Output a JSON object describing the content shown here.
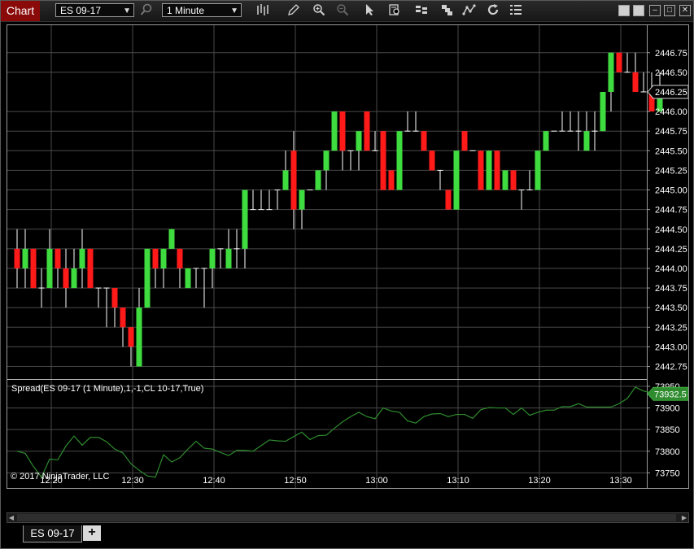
{
  "toolbar": {
    "chart_tab": "Chart",
    "instrument": "ES 09-17",
    "interval": "1 Minute"
  },
  "indicator_label": "Spread(ES 09-17 (1 Minute),1,-1,CL 10-17,True)",
  "copyright": "© 2017 NinjaTrader, LLC",
  "bottom_tab": "ES 09-17",
  "add_tab_label": "+",
  "colors": {
    "up": "#3fdc3f",
    "down": "#ff1a1a",
    "grid": "#4a4a4a",
    "spread": "#2e8b2e",
    "marker_fill": "#000000"
  },
  "chart_data": [
    {
      "type": "candlestick",
      "instrument": "ES 09-17",
      "interval": "1 Minute",
      "x_tick_labels": [
        "12:20",
        "12:30",
        "12:40",
        "12:50",
        "13:00",
        "13:10",
        "13:20",
        "13:30"
      ],
      "y_tick_labels": [
        "2446.75",
        "2446.50",
        "2446.00",
        "2445.75",
        "2445.50",
        "2445.25",
        "2445.00",
        "2444.75",
        "2444.50",
        "2444.25",
        "2444.00",
        "2443.75",
        "2443.50",
        "2443.25",
        "2443.00",
        "2442.75"
      ],
      "ylim": [
        2442.6,
        2447.1
      ],
      "last_price_label": "2446.25",
      "last_price": 2446.25,
      "bars": [
        [
          2444.25,
          2444.5,
          2443.75,
          2444.0
        ],
        [
          2444.0,
          2444.5,
          2443.75,
          2444.25
        ],
        [
          2444.25,
          2444.25,
          2443.75,
          2443.75
        ],
        [
          2443.75,
          2444.0,
          2443.5,
          2443.75
        ],
        [
          2443.75,
          2444.5,
          2443.75,
          2444.25
        ],
        [
          2444.25,
          2444.25,
          2443.75,
          2444.0
        ],
        [
          2444.0,
          2444.25,
          2443.5,
          2443.75
        ],
        [
          2443.75,
          2444.25,
          2443.75,
          2444.0
        ],
        [
          2444.0,
          2444.5,
          2443.75,
          2444.25
        ],
        [
          2444.25,
          2444.25,
          2443.75,
          2443.75
        ],
        [
          2443.75,
          2443.75,
          2443.5,
          2443.75
        ],
        [
          2443.75,
          2443.75,
          2443.25,
          2443.75
        ],
        [
          2443.75,
          2443.75,
          2443.25,
          2443.5
        ],
        [
          2443.5,
          2443.5,
          2443.0,
          2443.25
        ],
        [
          2443.25,
          2443.25,
          2442.75,
          2443.0
        ],
        [
          2442.75,
          2443.75,
          2442.75,
          2443.5
        ],
        [
          2443.5,
          2444.25,
          2443.5,
          2444.25
        ],
        [
          2444.25,
          2444.25,
          2443.75,
          2444.0
        ],
        [
          2444.0,
          2444.25,
          2443.75,
          2444.25
        ],
        [
          2444.25,
          2444.5,
          2444.25,
          2444.5
        ],
        [
          2444.25,
          2444.25,
          2443.75,
          2444.0
        ],
        [
          2443.75,
          2444.0,
          2443.75,
          2444.0
        ],
        [
          2444.0,
          2444.0,
          2443.75,
          2444.0
        ],
        [
          2444.0,
          2444.0,
          2443.5,
          2444.0
        ],
        [
          2444.0,
          2444.25,
          2443.75,
          2444.25
        ],
        [
          2444.25,
          2444.25,
          2444.0,
          2444.25
        ],
        [
          2444.0,
          2444.5,
          2444.0,
          2444.25
        ],
        [
          2444.25,
          2444.5,
          2444.0,
          2444.25
        ],
        [
          2444.25,
          2445.0,
          2444.0,
          2445.0
        ],
        [
          2444.75,
          2445.0,
          2444.75,
          2444.75
        ],
        [
          2444.75,
          2445.0,
          2444.75,
          2444.75
        ],
        [
          2444.75,
          2445.0,
          2444.75,
          2444.75
        ],
        [
          2445.0,
          2445.0,
          2444.75,
          2445.0
        ],
        [
          2445.0,
          2445.5,
          2445.0,
          2445.25
        ],
        [
          2445.5,
          2445.75,
          2444.5,
          2444.75
        ],
        [
          2444.75,
          2445.0,
          2444.5,
          2445.0
        ],
        [
          2445.0,
          2445.0,
          2445.0,
          2445.0
        ],
        [
          2445.0,
          2445.25,
          2445.0,
          2445.25
        ],
        [
          2445.25,
          2445.5,
          2445.0,
          2445.5
        ],
        [
          2445.5,
          2446.0,
          2445.5,
          2446.0
        ],
        [
          2446.0,
          2446.0,
          2445.25,
          2445.5
        ],
        [
          2445.5,
          2445.5,
          2445.25,
          2445.5
        ],
        [
          2445.5,
          2445.75,
          2445.25,
          2445.75
        ],
        [
          2446.0,
          2446.0,
          2445.5,
          2445.5
        ],
        [
          2445.5,
          2445.75,
          2445.5,
          2445.5
        ],
        [
          2445.75,
          2445.75,
          2445.0,
          2445.0
        ],
        [
          2445.25,
          2445.25,
          2445.0,
          2445.0
        ],
        [
          2445.0,
          2445.75,
          2445.0,
          2445.75
        ],
        [
          2445.75,
          2446.0,
          2445.75,
          2445.75
        ],
        [
          2445.75,
          2446.0,
          2445.75,
          2445.75
        ],
        [
          2445.75,
          2445.75,
          2445.5,
          2445.5
        ],
        [
          2445.5,
          2445.5,
          2445.25,
          2445.25
        ],
        [
          2445.25,
          2445.25,
          2445.0,
          2445.25
        ],
        [
          2445.0,
          2445.0,
          2444.75,
          2444.75
        ],
        [
          2444.75,
          2445.5,
          2444.75,
          2445.5
        ],
        [
          2445.75,
          2445.75,
          2445.5,
          2445.5
        ],
        [
          2445.5,
          2445.5,
          2445.5,
          2445.5
        ],
        [
          2445.5,
          2445.5,
          2445.0,
          2445.0
        ],
        [
          2445.0,
          2445.5,
          2445.0,
          2445.5
        ],
        [
          2445.5,
          2445.5,
          2445.0,
          2445.0
        ],
        [
          2445.0,
          2445.25,
          2445.0,
          2445.25
        ],
        [
          2445.25,
          2445.25,
          2445.0,
          2445.0
        ],
        [
          2445.0,
          2445.0,
          2444.75,
          2445.0
        ],
        [
          2445.0,
          2445.25,
          2445.0,
          2445.0
        ],
        [
          2445.0,
          2445.5,
          2445.0,
          2445.5
        ],
        [
          2445.5,
          2445.75,
          2445.5,
          2445.75
        ],
        [
          2445.75,
          2445.75,
          2445.75,
          2445.75
        ],
        [
          2445.75,
          2446.0,
          2445.75,
          2445.75
        ],
        [
          2445.75,
          2446.0,
          2445.75,
          2445.75
        ],
        [
          2445.75,
          2446.0,
          2445.5,
          2445.75
        ],
        [
          2445.5,
          2446.0,
          2445.5,
          2445.75
        ],
        [
          2445.75,
          2446.0,
          2445.5,
          2445.75
        ],
        [
          2445.75,
          2446.25,
          2445.75,
          2446.25
        ],
        [
          2446.25,
          2446.75,
          2446.0,
          2446.75
        ],
        [
          2446.75,
          2446.75,
          2446.5,
          2446.5
        ],
        [
          2446.5,
          2446.75,
          2446.5,
          2446.5
        ],
        [
          2446.5,
          2446.75,
          2446.25,
          2446.25
        ],
        [
          2446.25,
          2446.5,
          2446.25,
          2446.25
        ],
        [
          2446.25,
          2446.5,
          2446.0,
          2446.0
        ],
        [
          2446.0,
          2446.5,
          2446.0,
          2446.25
        ]
      ]
    },
    {
      "type": "line",
      "name": "Spread(ES 09-17 (1 Minute),1,-1,CL 10-17,True)",
      "y_tick_labels": [
        "73950",
        "73900",
        "73850",
        "73800",
        "73750"
      ],
      "ylim": [
        73715,
        73965
      ],
      "last_value_label": "73932.5",
      "last_value": 73932.5,
      "values": [
        73800,
        73795,
        73765,
        73740,
        73782,
        73780,
        73812,
        73835,
        73814,
        73832,
        73832,
        73822,
        73805,
        73796,
        73771,
        73756,
        73743,
        73740,
        73792,
        73775,
        73785,
        73805,
        73823,
        73807,
        73805,
        73797,
        73790,
        73802,
        73802,
        73800,
        73813,
        73826,
        73824,
        73823,
        73834,
        73844,
        73827,
        73836,
        73837,
        73853,
        73868,
        73880,
        73890,
        73880,
        73875,
        73900,
        73893,
        73890,
        73870,
        73865,
        73880,
        73886,
        73887,
        73880,
        73885,
        73885,
        73876,
        73896,
        73901,
        73900,
        73900,
        73885,
        73900,
        73883,
        73890,
        73895,
        73895,
        73903,
        73903,
        73910,
        73902,
        73902,
        73902,
        73902,
        73910,
        73922,
        73948,
        73939,
        73935,
        73935,
        73930,
        73932.5
      ]
    }
  ]
}
